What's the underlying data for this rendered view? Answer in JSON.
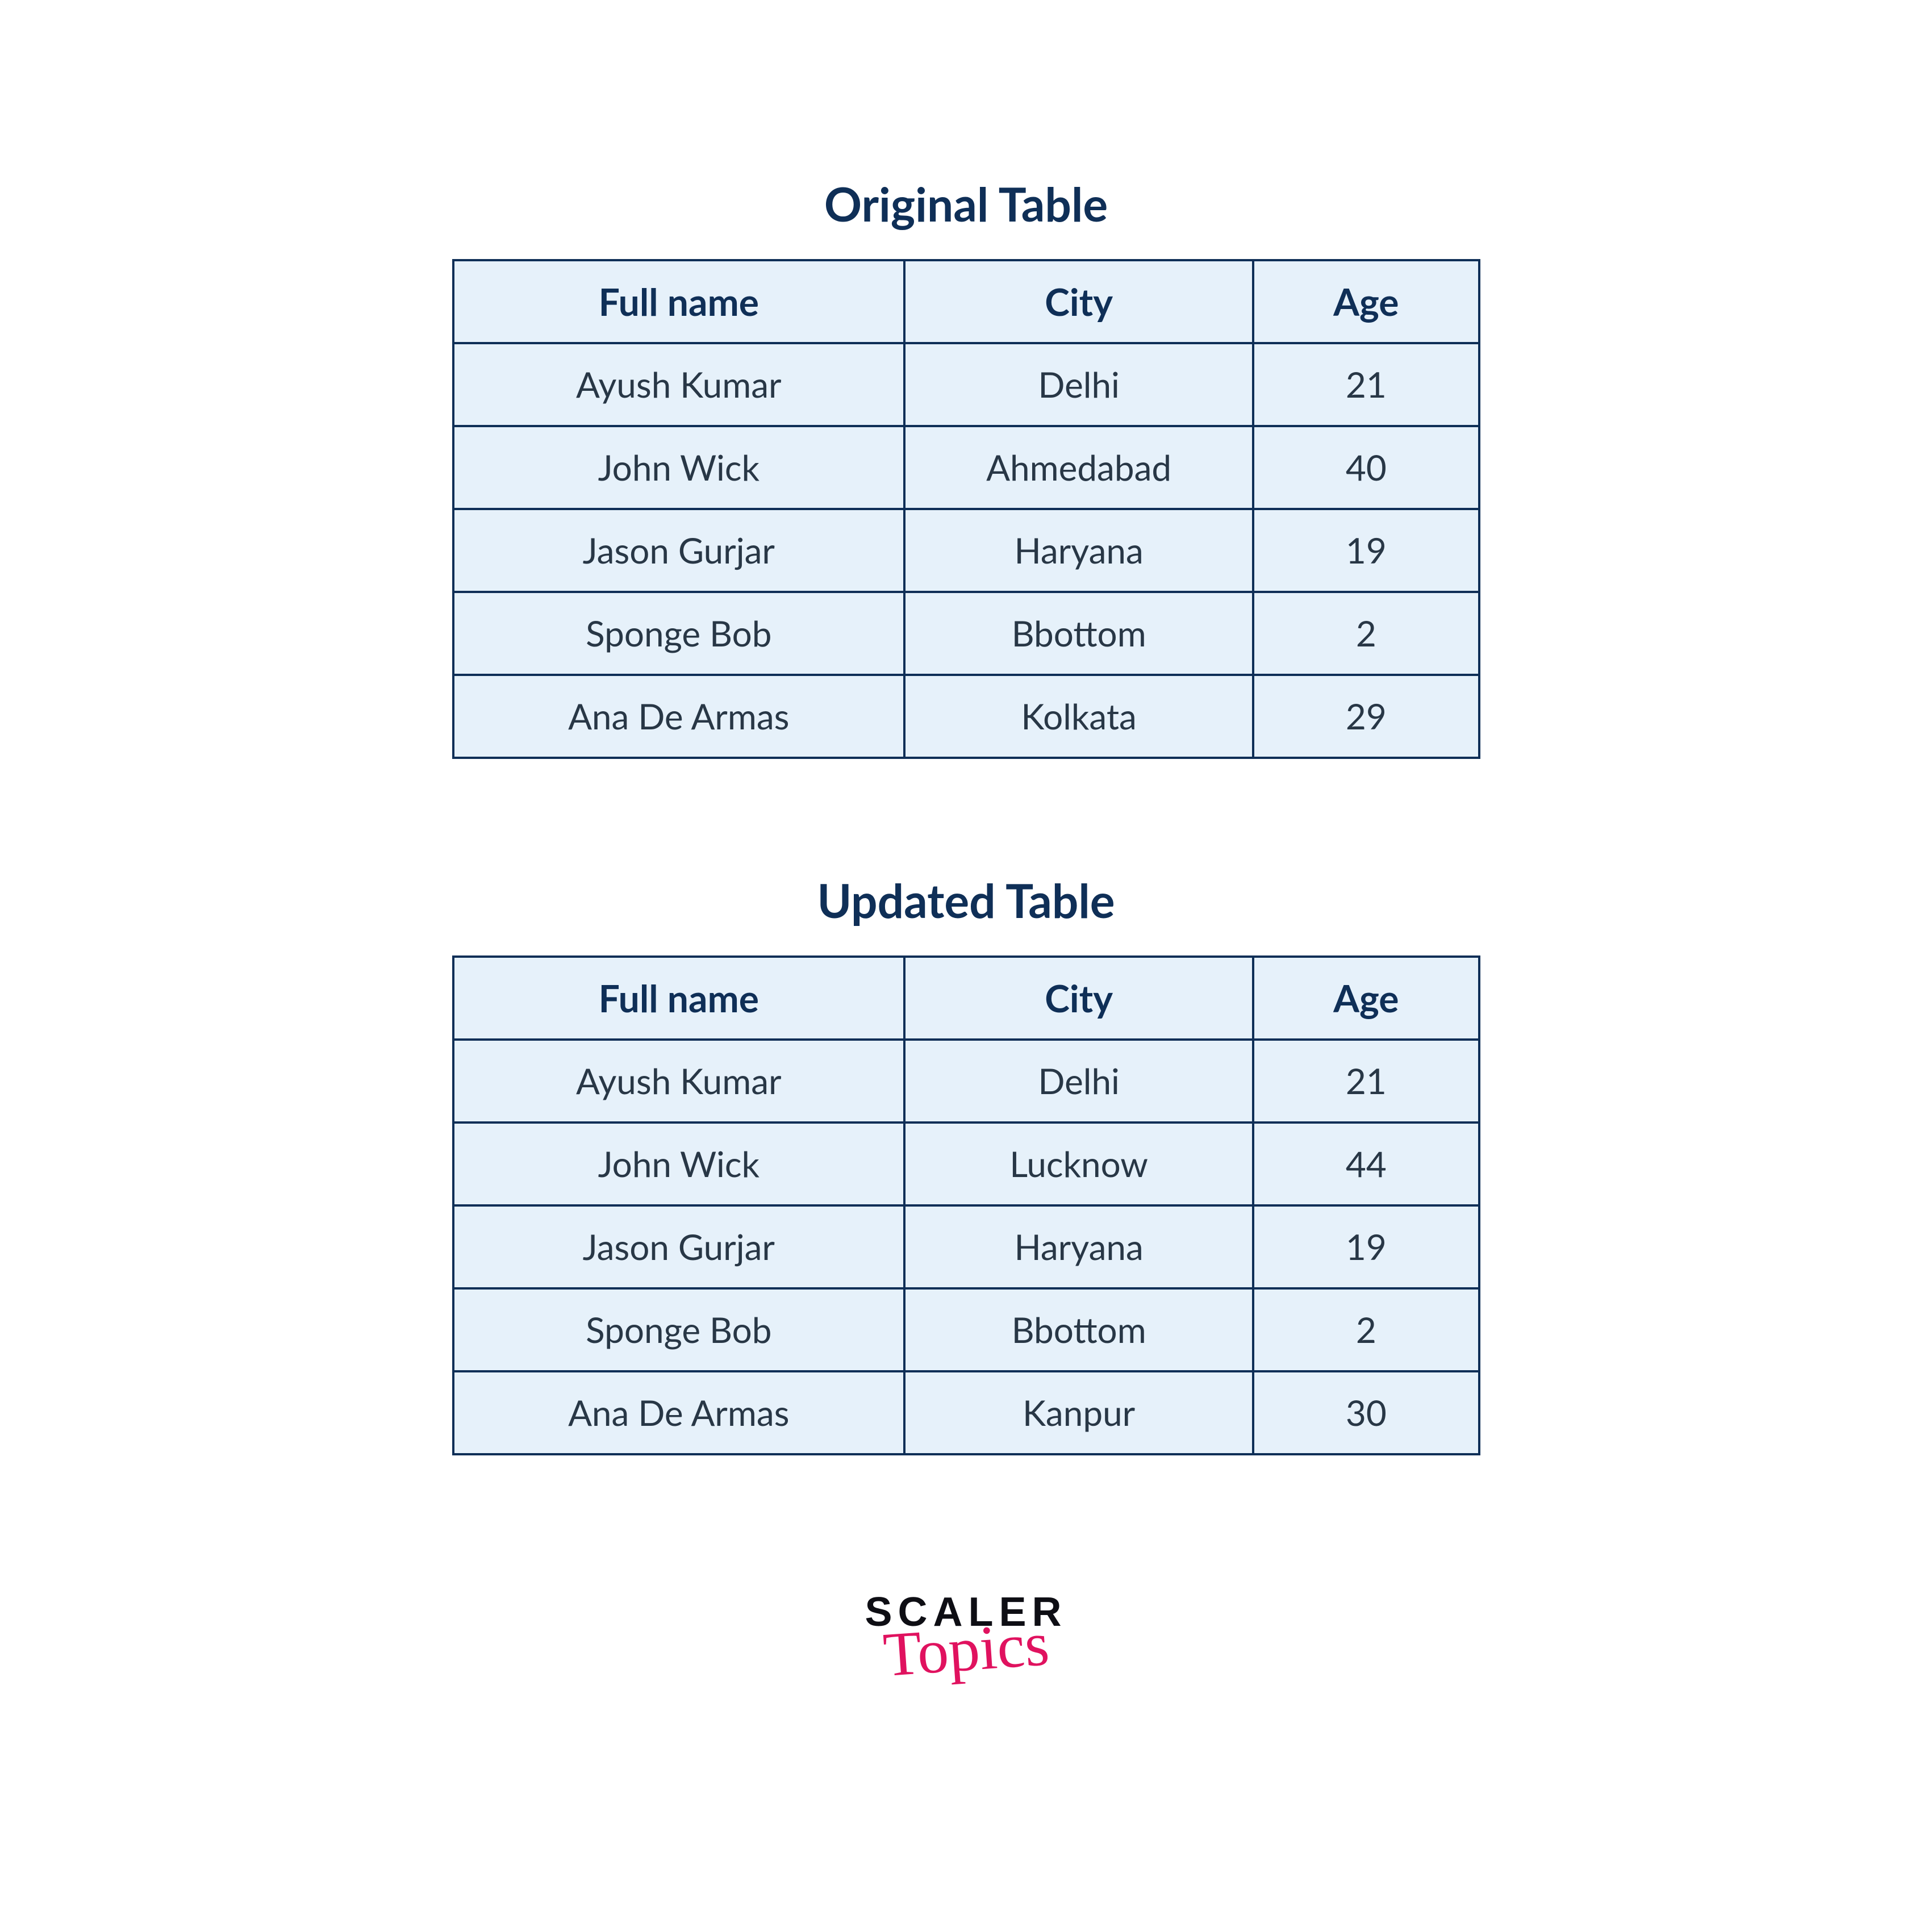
{
  "tables": [
    {
      "title": "Original Table",
      "headers": [
        "Full name",
        "City",
        "Age"
      ],
      "rows": [
        [
          "Ayush Kumar",
          "Delhi",
          "21"
        ],
        [
          "John Wick",
          "Ahmedabad",
          "40"
        ],
        [
          "Jason Gurjar",
          "Haryana",
          "19"
        ],
        [
          "Sponge Bob",
          "Bbottom",
          "2"
        ],
        [
          "Ana De Armas",
          "Kolkata",
          "29"
        ]
      ]
    },
    {
      "title": "Updated Table",
      "headers": [
        "Full name",
        "City",
        "Age"
      ],
      "rows": [
        [
          "Ayush Kumar",
          "Delhi",
          "21"
        ],
        [
          "John Wick",
          "Lucknow",
          "44"
        ],
        [
          "Jason Gurjar",
          "Haryana",
          "19"
        ],
        [
          "Sponge Bob",
          "Bbottom",
          "2"
        ],
        [
          "Ana De Armas",
          "Kanpur",
          "30"
        ]
      ]
    }
  ],
  "logo": {
    "line1": "SCALER",
    "line2": "Topics"
  }
}
